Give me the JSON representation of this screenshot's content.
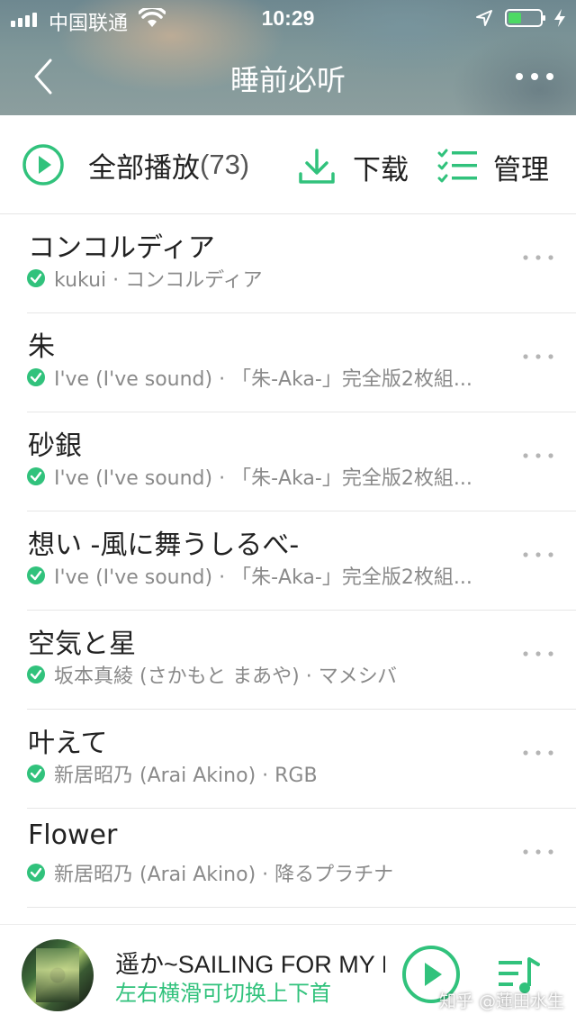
{
  "statusbar": {
    "carrier": "中国联通",
    "time": "10:29",
    "battery_level": 0.35,
    "icons": [
      "signal-icon",
      "wifi-icon",
      "location-icon",
      "battery-icon",
      "charging-icon"
    ]
  },
  "header": {
    "title": "睡前必听",
    "back_icon": "chevron-left-icon",
    "more_icon": "more-dots-icon"
  },
  "actions": {
    "play_all_label": "全部播放",
    "play_all_count": "(73)",
    "download_label": "下载",
    "manage_label": "管理"
  },
  "songs": [
    {
      "title": "コンコルディア",
      "subtitle": "kukui · コンコルディア",
      "downloaded": true
    },
    {
      "title": "朱",
      "subtitle": "I've (I've sound) · 「朱-Aka-」完全版2枚組...",
      "downloaded": true
    },
    {
      "title": "砂銀",
      "subtitle": "I've (I've sound) · 「朱-Aka-」完全版2枚組...",
      "downloaded": true
    },
    {
      "title": "想い -風に舞うしるべ-",
      "subtitle": "I've (I've sound) · 「朱-Aka-」完全版2枚組...",
      "downloaded": true
    },
    {
      "title": "空気と星",
      "subtitle": "坂本真綾 (さかもと まあや) · マメシバ",
      "downloaded": true
    },
    {
      "title": "叶えて",
      "subtitle": "新居昭乃 (Arai Akino) · RGB",
      "downloaded": true
    },
    {
      "title": "Flower",
      "subtitle": "新居昭乃 (Arai Akino) · 降るプラチナ",
      "downloaded": true
    }
  ],
  "player": {
    "now_playing": "遥か~SAILING FOR MY DREAM~",
    "hint": "左右横滑可切换上下首",
    "watermark": "知乎 @蓮田水生"
  },
  "colors": {
    "accent": "#31c27c",
    "text": "#222222",
    "subtext": "#8a8a8a",
    "divider": "#e6e6e6"
  }
}
